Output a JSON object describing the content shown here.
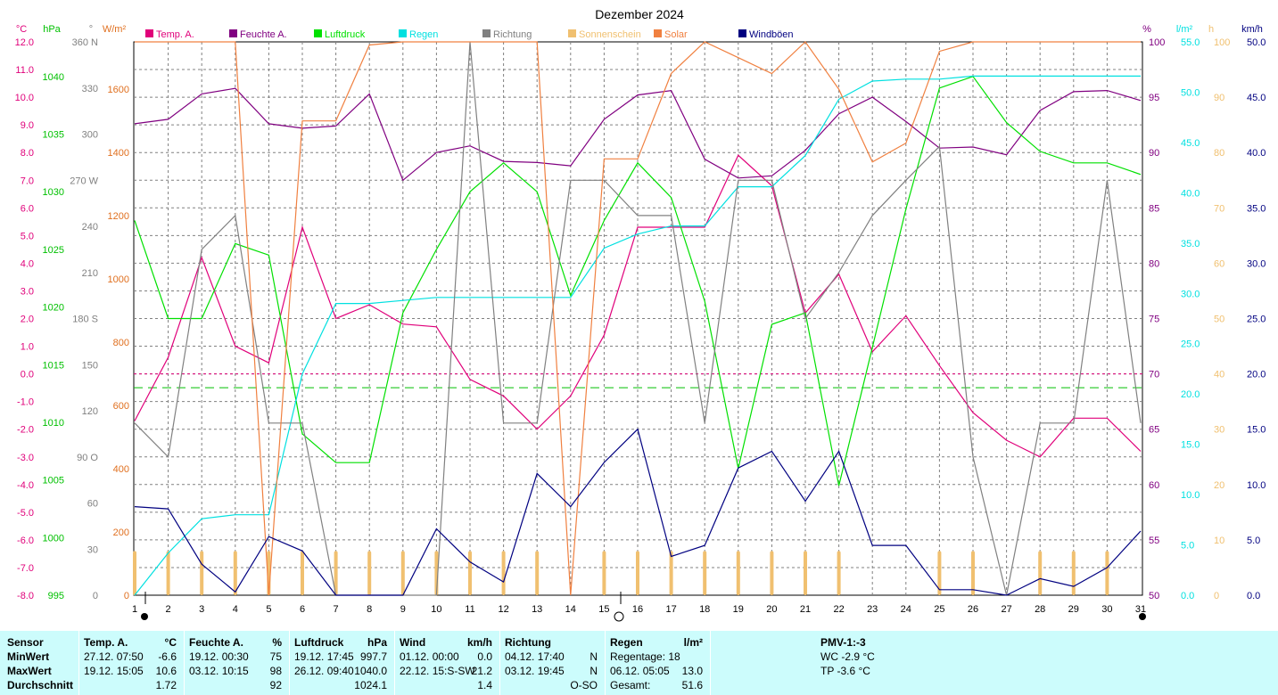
{
  "chart_data": {
    "type": "line",
    "title": "Dezember 2024",
    "x": [
      1,
      2,
      3,
      4,
      5,
      6,
      7,
      8,
      9,
      10,
      11,
      12,
      13,
      14,
      15,
      16,
      17,
      18,
      19,
      20,
      21,
      22,
      23,
      24,
      25,
      26,
      27,
      28,
      29,
      30,
      31
    ],
    "axes": {
      "temp": {
        "unit": "°C",
        "color": "#e0007a",
        "min": -8.0,
        "max": 12.0,
        "ticks": [
          "12.0",
          "11.0",
          "10.0",
          "9.0",
          "8.0",
          "7.0",
          "6.0",
          "5.0",
          "4.0",
          "3.0",
          "2.0",
          "1.0",
          "0.0",
          "-1.0",
          "-2.0",
          "-3.0",
          "-4.0",
          "-5.0",
          "-6.0",
          "-7.0",
          "-8.0"
        ]
      },
      "pressure": {
        "unit": "hPa",
        "color": "#00c000",
        "min": 995,
        "max": 1043,
        "ticks": [
          "1040",
          "1035",
          "1030",
          "1025",
          "1020",
          "1015",
          "1010",
          "1005",
          "1000",
          "995"
        ]
      },
      "direction": {
        "unit": "°",
        "color": "#808080",
        "min": 0,
        "max": 360,
        "ticks": [
          "360 N",
          "330",
          "300",
          "270 W",
          "240",
          "210",
          "180 S",
          "150",
          "120",
          "90 O",
          "60",
          "30",
          "0"
        ]
      },
      "solar": {
        "unit": "W/m²",
        "color": "#e07020",
        "min": 0,
        "max": 1750,
        "ticks": [
          "1600",
          "1400",
          "1200",
          "1000",
          "800",
          "600",
          "400",
          "200",
          "0"
        ]
      },
      "humidity": {
        "unit": "%",
        "color": "#800080",
        "min": 50,
        "max": 100,
        "ticks": [
          "100",
          "95",
          "90",
          "85",
          "80",
          "75",
          "70",
          "65",
          "60",
          "55",
          "50"
        ]
      },
      "rain": {
        "unit": "l/m²",
        "color": "#00e0e0",
        "min": 0,
        "max": 55,
        "ticks": [
          "55.0",
          "50.0",
          "45.0",
          "40.0",
          "35.0",
          "30.0",
          "25.0",
          "20.0",
          "15.0",
          "10.0",
          "5.0",
          "0.0"
        ]
      },
      "sunshine": {
        "unit": "h",
        "color": "#f0c070",
        "min": 0,
        "max": 100,
        "ticks": [
          "100",
          "90",
          "80",
          "70",
          "60",
          "50",
          "40",
          "30",
          "20",
          "10",
          "0"
        ]
      },
      "wind": {
        "unit": "km/h",
        "color": "#000080",
        "min": 0,
        "max": 50,
        "ticks": [
          "50.0",
          "45.0",
          "40.0",
          "35.0",
          "30.0",
          "25.0",
          "20.0",
          "15.0",
          "10.0",
          "5.0",
          "0.0"
        ]
      }
    },
    "legend": [
      {
        "label": "Temp. A.",
        "color": "#e0007a"
      },
      {
        "label": "Feuchte A.",
        "color": "#800080"
      },
      {
        "label": "Luftdruck",
        "color": "#00e000"
      },
      {
        "label": "Regen",
        "color": "#00e0e0"
      },
      {
        "label": "Richtung",
        "color": "#808080"
      },
      {
        "label": "Sonnenschein",
        "color": "#f0c070"
      },
      {
        "label": "Solar",
        "color": "#f08040"
      },
      {
        "label": "Windböen",
        "color": "#000080"
      }
    ],
    "series": [
      {
        "name": "Temp. A.",
        "axis": "temp",
        "color": "#e0007a",
        "values": [
          -1.7,
          0.6,
          4.2,
          1.0,
          0.4,
          5.3,
          2.0,
          2.5,
          1.8,
          1.7,
          -0.2,
          -0.8,
          -2.0,
          -0.8,
          1.4,
          5.3,
          5.3,
          5.3,
          7.9,
          6.8,
          2.2,
          3.6,
          0.8,
          2.1,
          0.3,
          -1.4,
          -2.4,
          -3.0,
          -1.6,
          -1.6,
          -2.8
        ]
      },
      {
        "name": "Feuchte A.",
        "axis": "humidity",
        "color": "#800080",
        "values": [
          92.6,
          93.0,
          95.3,
          95.8,
          92.6,
          92.2,
          92.4,
          95.3,
          87.5,
          90.0,
          90.6,
          89.2,
          89.1,
          88.8,
          93.0,
          95.2,
          95.6,
          89.4,
          87.7,
          87.9,
          90.2,
          93.5,
          95.0,
          92.8,
          90.4,
          90.5,
          89.8,
          93.8,
          95.5,
          95.6,
          94.7
        ]
      },
      {
        "name": "Luftdruck",
        "axis": "pressure",
        "color": "#00e000",
        "values": [
          1027.5,
          1019.0,
          1019.0,
          1025.5,
          1024.5,
          1009.0,
          1006.5,
          1006.5,
          1019.5,
          1025.0,
          1030.0,
          1032.5,
          1030.0,
          1021.0,
          1027.5,
          1032.5,
          1029.5,
          1020.5,
          1006.0,
          1018.5,
          1019.5,
          1004.5,
          1016.5,
          1028.5,
          1039.0,
          1040.0,
          1036.0,
          1033.5,
          1032.5,
          1032.5,
          1031.5
        ]
      },
      {
        "name": "Regen",
        "axis": "rain",
        "color": "#00e0e0",
        "values": [
          0.0,
          4.2,
          7.6,
          8.0,
          8.0,
          22.0,
          29.0,
          29.0,
          29.3,
          29.6,
          29.6,
          29.6,
          29.6,
          29.6,
          34.5,
          35.9,
          36.7,
          36.7,
          40.6,
          40.6,
          43.7,
          49.3,
          51.1,
          51.3,
          51.3,
          51.6,
          51.6,
          51.6,
          51.6,
          51.6,
          51.6
        ]
      },
      {
        "name": "Richtung",
        "axis": "direction",
        "color": "#808080",
        "values": [
          112,
          90,
          225,
          247,
          112,
          112,
          0,
          0,
          0,
          0,
          360,
          112,
          112,
          270,
          270,
          247,
          247,
          112,
          270,
          270,
          180,
          210,
          247,
          270,
          292,
          90,
          0,
          112,
          112,
          270,
          112
        ]
      },
      {
        "name": "Solar",
        "axis": "solar",
        "color": "#f08040",
        "values": [
          1750,
          1750,
          1750,
          1750,
          0,
          1500,
          1500,
          1740,
          1750,
          1750,
          1750,
          1750,
          1750,
          0,
          1380,
          1380,
          1650,
          1750,
          1700,
          1650,
          1750,
          1600,
          1370,
          1430,
          1720,
          1750,
          1750,
          1750,
          1750,
          1750,
          1750
        ]
      },
      {
        "name": "Windböen",
        "axis": "wind",
        "color": "#000080",
        "values": [
          8.0,
          7.8,
          2.8,
          0.3,
          5.3,
          4.0,
          0.0,
          0.0,
          0.0,
          6.0,
          3.0,
          1.2,
          11.0,
          8.0,
          12.0,
          15.0,
          3.5,
          4.5,
          11.5,
          13.0,
          8.5,
          13.0,
          4.5,
          4.5,
          0.5,
          0.5,
          0.0,
          1.5,
          0.8,
          2.5,
          5.8
        ]
      },
      {
        "name": "Sonnenschein",
        "axis": "sunshine",
        "color": "#f0c070",
        "type": "bar",
        "values": [
          8,
          8,
          8,
          8,
          8,
          8,
          8,
          8,
          8,
          8,
          8,
          8,
          8,
          0,
          8,
          8,
          8,
          8,
          8,
          8,
          8,
          8,
          0,
          0,
          8,
          8,
          0,
          8,
          8,
          8,
          0
        ]
      }
    ],
    "reference_lines": [
      {
        "axis": "temp",
        "value": 0.0,
        "color": "#e0007a",
        "style": "dashed"
      },
      {
        "axis": "pressure",
        "value": 1013.0,
        "color": "#00c000",
        "style": "dashed"
      }
    ],
    "grid": true
  },
  "stats": {
    "sensor": {
      "title": "Sensor",
      "rows": [
        "MinWert",
        "MaxWert",
        "Durchschnitt"
      ]
    },
    "temp": {
      "title": "Temp. A.",
      "unit": "°C",
      "min_time": "27.12.  07:50",
      "min_val": "-6.6",
      "max_time": "19.12.  15:05",
      "max_val": "10.6",
      "avg": "1.72"
    },
    "humidity": {
      "title": "Feuchte A.",
      "unit": "%",
      "min_time": "19.12.  00:30",
      "min_val": "75",
      "max_time": "03.12.  10:15",
      "max_val": "98",
      "avg": "92"
    },
    "pressure": {
      "title": "Luftdruck",
      "unit": "hPa",
      "min_time": "19.12.  17:45",
      "min_val": "997.7",
      "max_time": "26.12.  09:40",
      "max_val": "1040.0",
      "avg": "1024.1"
    },
    "wind": {
      "title": "Wind",
      "unit": "km/h",
      "min_time": "01.12.  00:00",
      "min_val": "0.0",
      "max_time": "22.12.  15:S-SW",
      "max_val": "21.2",
      "avg": "1.4"
    },
    "direction": {
      "title": "Richtung",
      "min_time": "04.12.  17:40",
      "min_val": "N",
      "max_time": "03.12.  19:45",
      "max_val": "N",
      "avg": "O-SO"
    },
    "rain": {
      "title": "Regen",
      "unit": "l/m²",
      "row1": "Regentage: 18",
      "row2_label": "06.12.  05:05",
      "row2_val": "13.0",
      "row3_label": "Gesamt:",
      "row3_val": "51.6"
    },
    "pmv": {
      "title": "PMV-1:-3",
      "wc": "WC -2.9 °C",
      "tp": "TP -3.6 °C"
    }
  }
}
